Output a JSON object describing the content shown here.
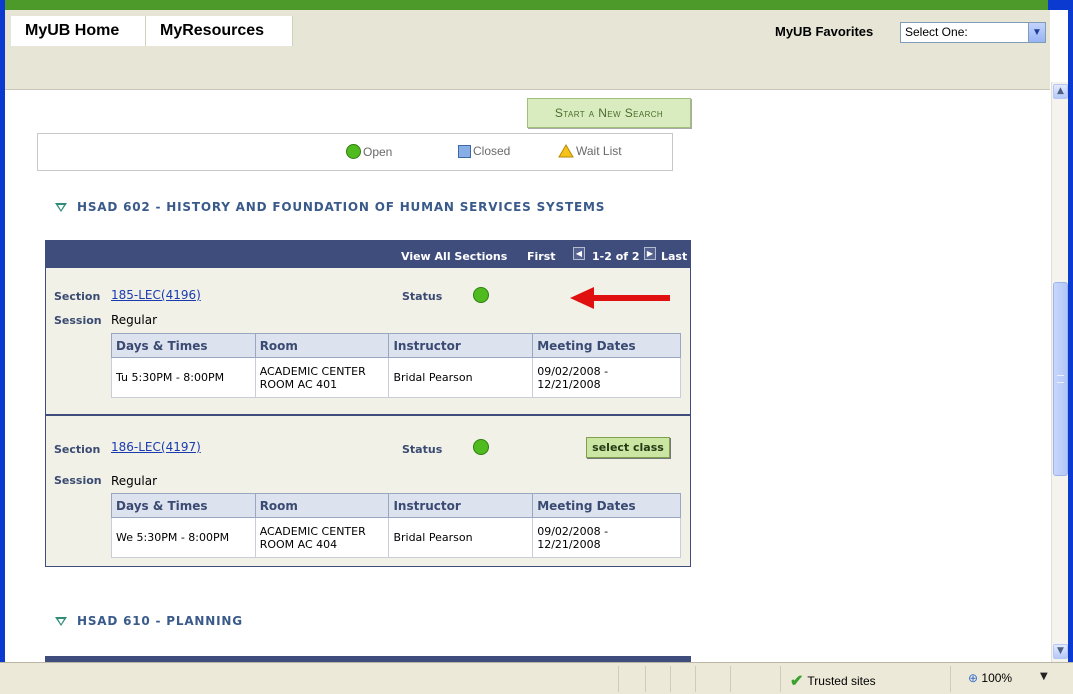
{
  "portal": {
    "tabs": [
      "MyUB Home",
      "MyResources"
    ],
    "favorites_label": "MyUB Favorites",
    "favorites_select": "Select One:"
  },
  "search": {
    "start_new_search": "Start a New Search"
  },
  "legend": {
    "open": "Open",
    "closed": "Closed",
    "wait_list": "Wait List"
  },
  "courses": [
    {
      "title": "HSAD  602 - HISTORY AND FOUNDATION OF  HUMAN SERVICES SYSTEMS",
      "nav": {
        "view_all": "View All Sections",
        "first": "First",
        "range": "1-2 of 2",
        "last": "Last"
      },
      "sections": [
        {
          "section_label": "Section",
          "section": "185-LEC(4196)",
          "status_label": "Status",
          "status": "Open",
          "session_label": "Session",
          "session": "Regular",
          "headers": [
            "Days & Times",
            "Room",
            "Instructor",
            "Meeting Dates"
          ],
          "days_times": "Tu 5:30PM - 8:00PM",
          "room_1": "ACADEMIC CENTER",
          "room_2": "ROOM AC 401",
          "instructor": "Bridal Pearson",
          "dates_1": "09/02/2008 -",
          "dates_2": "12/21/2008"
        },
        {
          "section_label": "Section",
          "section": "186-LEC(4197)",
          "status_label": "Status",
          "status": "Open",
          "session_label": "Session",
          "session": "Regular",
          "select_button": "select class",
          "headers": [
            "Days & Times",
            "Room",
            "Instructor",
            "Meeting Dates"
          ],
          "days_times": "We 5:30PM - 8:00PM",
          "room_1": "ACADEMIC CENTER",
          "room_2": "ROOM AC 404",
          "instructor": "Bridal Pearson",
          "dates_1": "09/02/2008 -",
          "dates_2": "12/21/2008"
        }
      ]
    },
    {
      "title": "HSAD  610 - PLANNING"
    }
  ],
  "statusbar": {
    "zone": "Trusted sites",
    "zoom": "100%"
  },
  "colors": {
    "open_status": "#4fbb1f",
    "header_bar": "#3f4d7d",
    "arrow": "#e01010"
  }
}
